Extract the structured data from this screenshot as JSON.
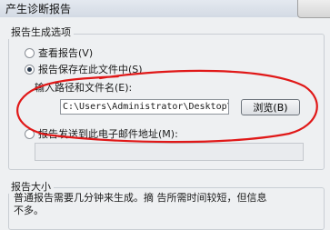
{
  "window": {
    "title": "产生诊断报告"
  },
  "options_group": {
    "legend": "报告生成选项",
    "view_report": {
      "label": "查看报告(V)",
      "selected": false
    },
    "save_report": {
      "label": "报告保存在此文件中(S)",
      "selected": true
    },
    "path_label": "输入路径和文件名(E):",
    "path_value": "C:\\Users\\Administrator\\Desktop\\dd.h",
    "browse_label": "浏览(B)",
    "email_report": {
      "label": "报告发送到此电子邮件地址(M):",
      "selected": false
    },
    "email_value": ""
  },
  "size_group": {
    "legend": "报告大小",
    "line1": "普通报告需要几分钟来生成。摘    告所需时间较短，但信息",
    "line2": "不多。"
  },
  "colors": {
    "annotation": "#e01818"
  },
  "icons": {
    "close": "close-icon"
  }
}
